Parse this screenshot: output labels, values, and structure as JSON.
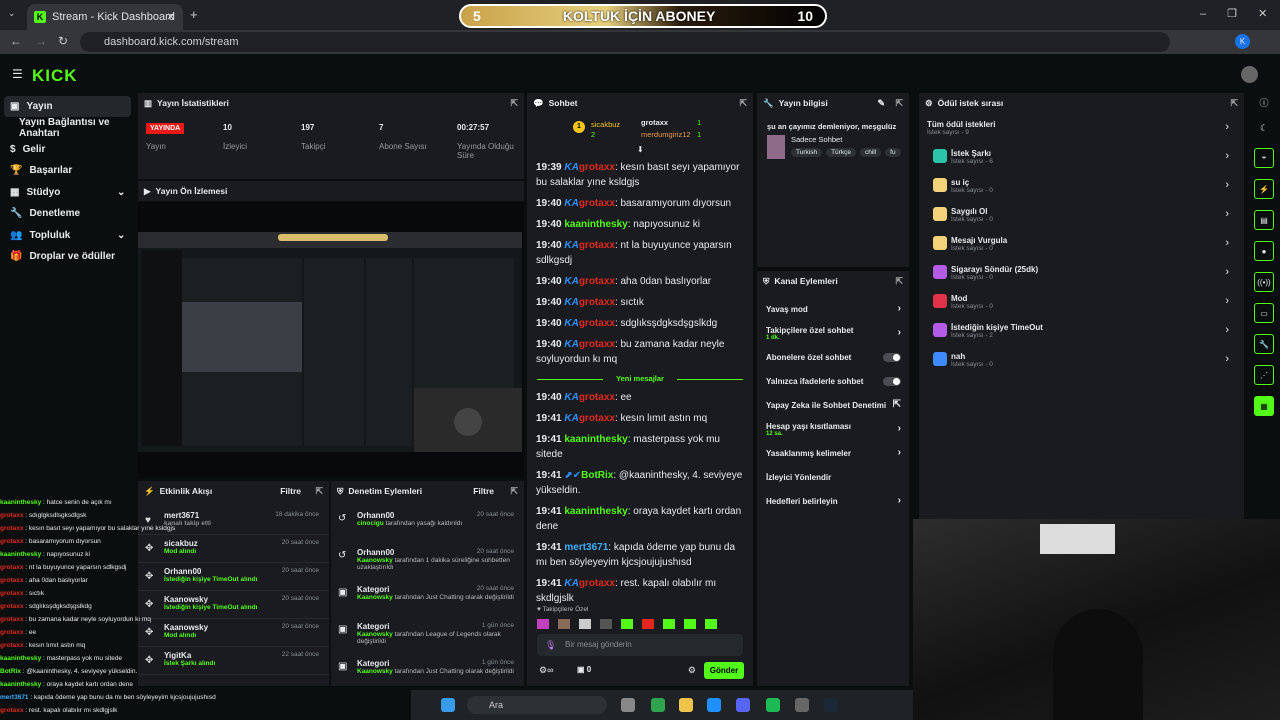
{
  "browser": {
    "tab_title": "Stream - Kick Dashboard",
    "url": "dashboard.kick.com/stream",
    "profile": "K"
  },
  "banner": {
    "left_num": "5",
    "text": "KOLTUK İÇİN ABONEY",
    "right_num": "10"
  },
  "brand": {
    "logo": "KICK",
    "accent": "#53fc18"
  },
  "sidebar": {
    "items": [
      {
        "label": "Yayın",
        "icon": "video-icon"
      },
      {
        "label": "Yayın Bağlantısı ve Anahtarı",
        "icon": ""
      },
      {
        "label": "Gelir",
        "icon": "dollar-icon"
      },
      {
        "label": "Başarılar",
        "icon": "trophy-icon"
      },
      {
        "label": "Stüdyo",
        "icon": "studio-icon"
      },
      {
        "label": "Denetleme",
        "icon": "wrench-icon"
      },
      {
        "label": "Topluluk",
        "icon": "users-icon"
      },
      {
        "label": "Droplar ve ödüller",
        "icon": "gift-icon"
      }
    ]
  },
  "stats": {
    "title": "Yayın İstatistikleri",
    "live": "YAYINDA",
    "live_label": "Yayın",
    "items": [
      {
        "value": "10",
        "label": "İzleyici"
      },
      {
        "value": "197",
        "label": "Takipçi"
      },
      {
        "value": "7",
        "label": "Abone Sayısı"
      },
      {
        "value": "00:27:57",
        "label": "Yayında Olduğu Süre"
      }
    ]
  },
  "preview": {
    "title": "Yayın Ön İzlemesi"
  },
  "activity": {
    "title": "Etkinlik Akışı",
    "filter": "Filtre",
    "items": [
      {
        "name": "mert3671",
        "detail": "kanalı takip etti",
        "time": "18 dakika önce",
        "icon": "heart-icon"
      },
      {
        "name": "sicakbuz",
        "detail": "Mod alındı",
        "time": "20 saat önce",
        "icon": "redeem-icon"
      },
      {
        "name": "Orhann00",
        "detail": "İstediğin kişiye TimeOut alındı",
        "time": "20 saat önce",
        "icon": "redeem-icon"
      },
      {
        "name": "Kaanowsky",
        "detail": "İstediğin kişiye TimeOut alındı",
        "time": "20 saat önce",
        "icon": "redeem-icon"
      },
      {
        "name": "Kaanowsky",
        "detail": "Mod alındı",
        "time": "20 saat önce",
        "icon": "redeem-icon"
      },
      {
        "name": "YigitKa",
        "detail": "İstek Şarkı alındı",
        "time": "22 saat önce",
        "icon": "redeem-icon"
      }
    ]
  },
  "moderation": {
    "title": "Denetim Eylemleri",
    "filter": "Filtre",
    "items": [
      {
        "name": "Orhann00",
        "actor": "cinocigu",
        "detail": "tarafından yasağı kaldırıldı",
        "time": "20 saat önce"
      },
      {
        "name": "Orhann00",
        "actor": "Kaanowsky",
        "detail": "tarafından 1 dakika süreliğine sohbetten uzaklaştırıldı",
        "time": "20 saat önce"
      },
      {
        "name": "Kategori",
        "actor": "Kaanowsky",
        "detail": "tarafından Just Chatting olarak değiştirildi",
        "time": "20 saat önce"
      },
      {
        "name": "Kategori",
        "actor": "Kaanowsky",
        "detail": "tarafından League of Legends olarak değiştirildi",
        "time": "1 gün önce"
      },
      {
        "name": "Kategori",
        "actor": "Kaanowsky",
        "detail": "tarafından Just Chatting olarak değiştirildi",
        "time": "1 gün önce"
      }
    ]
  },
  "chat": {
    "title": "Sohbet",
    "top": {
      "first": "sicakbuz",
      "first_count": "2",
      "second": "grotaxx",
      "second_count": "1",
      "third": "merdumgiriz12",
      "third_count": "1"
    },
    "messages": [
      {
        "time": "19:39",
        "badge": "KA",
        "user": "grotaxx",
        "color": "red",
        "text": "kesın basıt seyı yapamıyor bu salaklar yıne ksldgjs"
      },
      {
        "time": "19:40",
        "badge": "KA",
        "user": "grotaxx",
        "color": "red",
        "text": "basaramıyorum dıyorsun"
      },
      {
        "time": "19:40",
        "badge": "",
        "user": "kaaninthesky",
        "color": "grn",
        "text": "napıyosunuz ki"
      },
      {
        "time": "19:40",
        "badge": "KA",
        "user": "grotaxx",
        "color": "red",
        "text": "nt la buyuyunce yaparsın sdlkgsdj"
      },
      {
        "time": "19:40",
        "badge": "KA",
        "user": "grotaxx",
        "color": "red",
        "text": "aha 0dan baslıyorlar"
      },
      {
        "time": "19:40",
        "badge": "KA",
        "user": "grotaxx",
        "color": "red",
        "text": "sıctık"
      },
      {
        "time": "19:40",
        "badge": "KA",
        "user": "grotaxx",
        "color": "red",
        "text": "sdglıksşdgksdşgslkdg"
      },
      {
        "time": "19:40",
        "badge": "KA",
        "user": "grotaxx",
        "color": "red",
        "text": "bu zamana kadar neyle soyluyordun kı mq"
      }
    ],
    "new_label": "Yeni mesajlar",
    "new_messages": [
      {
        "time": "19:40",
        "badge": "KA",
        "user": "grotaxx",
        "color": "red",
        "text": "ee"
      },
      {
        "time": "19:41",
        "badge": "KA",
        "user": "grotaxx",
        "color": "red",
        "text": "kesın lımıt astın mq"
      },
      {
        "time": "19:41",
        "badge": "",
        "user": "kaaninthesky",
        "color": "grn",
        "text": "masterpass yok mu sitede"
      },
      {
        "time": "19:41",
        "badge": "BOT",
        "user": "BotRix",
        "color": "grn",
        "text": "@kaaninthesky, 4. seviyeye yükseldin."
      },
      {
        "time": "19:41",
        "badge": "",
        "user": "kaaninthesky",
        "color": "grn",
        "text": "oraya kaydet kartı ordan dene"
      },
      {
        "time": "19:41",
        "badge": "",
        "user": "mert3671",
        "color": "blu",
        "text": "kapıda ödeme yap bunu da mı ben söyleyeyim kjcsjoujujushısd"
      },
      {
        "time": "19:41",
        "badge": "KA",
        "user": "grotaxx",
        "color": "red",
        "text": "rest. kapalı olabılır mı skdlgjslk"
      }
    ],
    "followers_only": "Takipçilere Özel",
    "placeholder": "Bir mesaj gönderin",
    "points": "0",
    "send": "Gönder"
  },
  "stream_info": {
    "title": "Yayın bilgisi",
    "stream_title": "şu an çayımız demleniyor, meşgulüz",
    "category": "Sadece Sohbet",
    "tags": [
      "Turkish",
      "Türkçe",
      "chill",
      "fu"
    ]
  },
  "channel_actions": {
    "title": "Kanal Eylemleri",
    "items": [
      {
        "label": "Yavaş mod",
        "sub": "",
        "type": "arrow"
      },
      {
        "label": "Takipçilere özel sohbet",
        "sub": "1 dk.",
        "type": "arrow"
      },
      {
        "label": "Abonelere özel sohbet",
        "sub": "",
        "type": "toggle"
      },
      {
        "label": "Yalnızca ifadelerle sohbet",
        "sub": "",
        "type": "toggle"
      },
      {
        "label": "Yapay Zeka ile Sohbet Denetimi",
        "sub": "",
        "type": "ext"
      },
      {
        "label": "Hesap yaşı kısıtlaması",
        "sub": "12 sa.",
        "type": "arrow"
      },
      {
        "label": "Yasaklanmış kelimeler",
        "sub": "",
        "type": "arrow"
      },
      {
        "label": "İzleyici Yönlendir",
        "sub": "",
        "type": "none"
      },
      {
        "label": "Hedefleri belirleyin",
        "sub": "",
        "type": "arrow"
      }
    ]
  },
  "rewards": {
    "title": "Ödül istek sırası",
    "all": "Tüm ödül istekleri",
    "all_count": "İstek sayısı - 9",
    "items": [
      {
        "name": "İstek Şarkı",
        "count": "İstek sayısı - 6",
        "color": "#2bc4a8"
      },
      {
        "name": "su iç",
        "count": "İstek sayısı - 0",
        "color": "#f3d27a"
      },
      {
        "name": "Saygılı Ol",
        "count": "İstek sayısı - 0",
        "color": "#f3d27a"
      },
      {
        "name": "Mesajı Vurgula",
        "count": "İstek sayısı - 0",
        "color": "#f3d27a"
      },
      {
        "name": "Sigarayı Söndür (25dk)",
        "count": "İstek sayısı - 0",
        "color": "#b45ce8"
      },
      {
        "name": "Mod",
        "count": "İstek sayısı - 0",
        "color": "#e2324a"
      },
      {
        "name": "İstediğin kişiye TimeOut",
        "count": "İstek sayısı - 2",
        "color": "#b45ce8"
      },
      {
        "name": "nah",
        "count": "İstek sayısı - 0",
        "color": "#3d8bff"
      }
    ]
  },
  "overlay_chat": [
    {
      "user": "kaaninthesky",
      "color": "grn",
      "text": "hatce senin de açık mı"
    },
    {
      "user": "grotaxx",
      "color": "red",
      "text": "sdıglgksdlsgksdlgsk"
    },
    {
      "user": "grotaxx",
      "color": "red",
      "text": "kesın basıt seyı yapamıyor bu salaklar yıne ksldgjs"
    },
    {
      "user": "grotaxx",
      "color": "red",
      "text": "basaramıyorum dıyorsun"
    },
    {
      "user": "kaaninthesky",
      "color": "grn",
      "text": "napıyosunuz ki"
    },
    {
      "user": "grotaxx",
      "color": "red",
      "text": "nt la buyuyunce yaparsın sdlkgsdj"
    },
    {
      "user": "grotaxx",
      "color": "red",
      "text": "aha 0dan baslıyorlar"
    },
    {
      "user": "grotaxx",
      "color": "red",
      "text": "sıctık"
    },
    {
      "user": "grotaxx",
      "color": "red",
      "text": "sdglıksşdgksdşgslkdg"
    },
    {
      "user": "grotaxx",
      "color": "red",
      "text": "bu zamana kadar neyle soyluyordun kı mq"
    },
    {
      "user": "grotaxx",
      "color": "red",
      "text": "ee"
    },
    {
      "user": "grotaxx",
      "color": "red",
      "text": "kesın lımıt astın mq"
    },
    {
      "user": "kaaninthesky",
      "color": "grn",
      "text": "masterpass yok mu sitede"
    },
    {
      "user": "BotRix",
      "color": "grn",
      "text": "@kaaninthesky, 4. seviyeye yükseldin."
    },
    {
      "user": "kaaninthesky",
      "color": "grn",
      "text": "oraya kaydet kartı ordan dene"
    },
    {
      "user": "mert3671",
      "color": "blu",
      "text": "kapıda ödeme yap bunu da mı ben söyleyeyim kjcsjoujujushısd"
    },
    {
      "user": "grotaxx",
      "color": "red",
      "text": "rest. kapalı olabılır mı skdlgjslk"
    }
  ],
  "taskbar": {
    "search": "Ara"
  }
}
